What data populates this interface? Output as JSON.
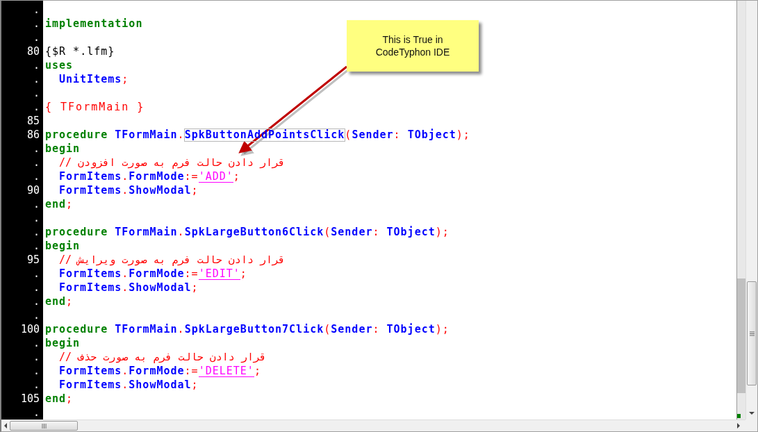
{
  "editor": {
    "lines": [
      {
        "number": "."
      },
      {
        "number": ".",
        "indented": false,
        "tokens": [
          {
            "kind": "keyword",
            "text": "implementation"
          }
        ]
      },
      {
        "number": "."
      },
      {
        "number": "80",
        "indented": false,
        "tokens": [
          {
            "kind": "directive",
            "text": "{$R *.lfm}"
          }
        ]
      },
      {
        "number": ".",
        "indented": false,
        "tokens": [
          {
            "kind": "keyword",
            "text": "uses"
          }
        ]
      },
      {
        "number": ".",
        "indented": true,
        "tokens": [
          {
            "kind": "ident",
            "text": "UnitItems"
          },
          {
            "kind": "symbol",
            "text": ";"
          }
        ]
      },
      {
        "number": "."
      },
      {
        "number": ".",
        "indented": false,
        "tokens": [
          {
            "kind": "comment",
            "text": "{ TFormMain }"
          }
        ]
      },
      {
        "number": "85"
      },
      {
        "number": "86",
        "indented": false,
        "tokens": [
          {
            "kind": "keyword",
            "text": "procedure "
          },
          {
            "kind": "ident",
            "text": "TFormMain"
          },
          {
            "kind": "symbol",
            "text": "."
          },
          {
            "kind": "ident",
            "text": "SpkButtonAddPointsClick",
            "boxed": true
          },
          {
            "kind": "symbol",
            "text": "("
          },
          {
            "kind": "ident",
            "text": "Sender"
          },
          {
            "kind": "symbol",
            "text": ": "
          },
          {
            "kind": "ident",
            "text": "TObject"
          },
          {
            "kind": "symbol",
            "text": ");"
          }
        ]
      },
      {
        "number": ".",
        "indented": false,
        "tokens": [
          {
            "kind": "keyword",
            "text": "begin"
          }
        ]
      },
      {
        "number": ".",
        "indented": true,
        "tokens": [
          {
            "kind": "comment",
            "text": "// قرار دادن حالت فرم به صورت افزودن"
          }
        ]
      },
      {
        "number": ".",
        "indented": true,
        "tokens": [
          {
            "kind": "ident",
            "text": "FormItems"
          },
          {
            "kind": "symbol",
            "text": "."
          },
          {
            "kind": "ident",
            "text": "FormMode"
          },
          {
            "kind": "symbol",
            "text": ":="
          },
          {
            "kind": "string",
            "text": "'ADD'"
          },
          {
            "kind": "symbol",
            "text": ";"
          }
        ]
      },
      {
        "number": "90",
        "indented": true,
        "tokens": [
          {
            "kind": "ident",
            "text": "FormItems"
          },
          {
            "kind": "symbol",
            "text": "."
          },
          {
            "kind": "ident",
            "text": "ShowModal"
          },
          {
            "kind": "symbol",
            "text": ";"
          }
        ]
      },
      {
        "number": ".",
        "indented": false,
        "tokens": [
          {
            "kind": "keyword",
            "text": "end"
          },
          {
            "kind": "symbol",
            "text": ";"
          }
        ]
      },
      {
        "number": "."
      },
      {
        "number": ".",
        "indented": false,
        "tokens": [
          {
            "kind": "keyword",
            "text": "procedure "
          },
          {
            "kind": "ident",
            "text": "TFormMain"
          },
          {
            "kind": "symbol",
            "text": "."
          },
          {
            "kind": "ident",
            "text": "SpkLargeButton6Click"
          },
          {
            "kind": "symbol",
            "text": "("
          },
          {
            "kind": "ident",
            "text": "Sender"
          },
          {
            "kind": "symbol",
            "text": ": "
          },
          {
            "kind": "ident",
            "text": "TObject"
          },
          {
            "kind": "symbol",
            "text": ");"
          }
        ]
      },
      {
        "number": ".",
        "indented": false,
        "tokens": [
          {
            "kind": "keyword",
            "text": "begin"
          }
        ]
      },
      {
        "number": "95",
        "indented": true,
        "tokens": [
          {
            "kind": "comment",
            "text": "// قرار دادن حالت فرم به صورت ویرایش"
          }
        ]
      },
      {
        "number": ".",
        "indented": true,
        "tokens": [
          {
            "kind": "ident",
            "text": "FormItems"
          },
          {
            "kind": "symbol",
            "text": "."
          },
          {
            "kind": "ident",
            "text": "FormMode"
          },
          {
            "kind": "symbol",
            "text": ":="
          },
          {
            "kind": "string",
            "text": "'EDIT'"
          },
          {
            "kind": "symbol",
            "text": ";"
          }
        ]
      },
      {
        "number": ".",
        "indented": true,
        "tokens": [
          {
            "kind": "ident",
            "text": "FormItems"
          },
          {
            "kind": "symbol",
            "text": "."
          },
          {
            "kind": "ident",
            "text": "ShowModal"
          },
          {
            "kind": "symbol",
            "text": ";"
          }
        ]
      },
      {
        "number": ".",
        "indented": false,
        "tokens": [
          {
            "kind": "keyword",
            "text": "end"
          },
          {
            "kind": "symbol",
            "text": ";"
          }
        ]
      },
      {
        "number": "."
      },
      {
        "number": "100",
        "indented": false,
        "tokens": [
          {
            "kind": "keyword",
            "text": "procedure "
          },
          {
            "kind": "ident",
            "text": "TFormMain"
          },
          {
            "kind": "symbol",
            "text": "."
          },
          {
            "kind": "ident",
            "text": "SpkLargeButton7Click"
          },
          {
            "kind": "symbol",
            "text": "("
          },
          {
            "kind": "ident",
            "text": "Sender"
          },
          {
            "kind": "symbol",
            "text": ": "
          },
          {
            "kind": "ident",
            "text": "TObject"
          },
          {
            "kind": "symbol",
            "text": ");"
          }
        ]
      },
      {
        "number": ".",
        "indented": false,
        "tokens": [
          {
            "kind": "keyword",
            "text": "begin"
          }
        ]
      },
      {
        "number": ".",
        "indented": true,
        "tokens": [
          {
            "kind": "comment",
            "text": "// قرار دادن حالت فرم به صورت حذف"
          }
        ]
      },
      {
        "number": ".",
        "indented": true,
        "tokens": [
          {
            "kind": "ident",
            "text": "FormItems"
          },
          {
            "kind": "symbol",
            "text": "."
          },
          {
            "kind": "ident",
            "text": "FormMode"
          },
          {
            "kind": "symbol",
            "text": ":="
          },
          {
            "kind": "string",
            "text": "'DELETE'"
          },
          {
            "kind": "symbol",
            "text": ";"
          }
        ]
      },
      {
        "number": ".",
        "indented": true,
        "tokens": [
          {
            "kind": "ident",
            "text": "FormItems"
          },
          {
            "kind": "symbol",
            "text": "."
          },
          {
            "kind": "ident",
            "text": "ShowModal"
          },
          {
            "kind": "symbol",
            "text": ";"
          }
        ]
      },
      {
        "number": "105",
        "indented": false,
        "tokens": [
          {
            "kind": "keyword",
            "text": "end"
          },
          {
            "kind": "symbol",
            "text": ";"
          }
        ]
      },
      {
        "number": "."
      }
    ]
  },
  "callout": {
    "lines": [
      "This is True in",
      "CodeTyphon IDE"
    ]
  }
}
